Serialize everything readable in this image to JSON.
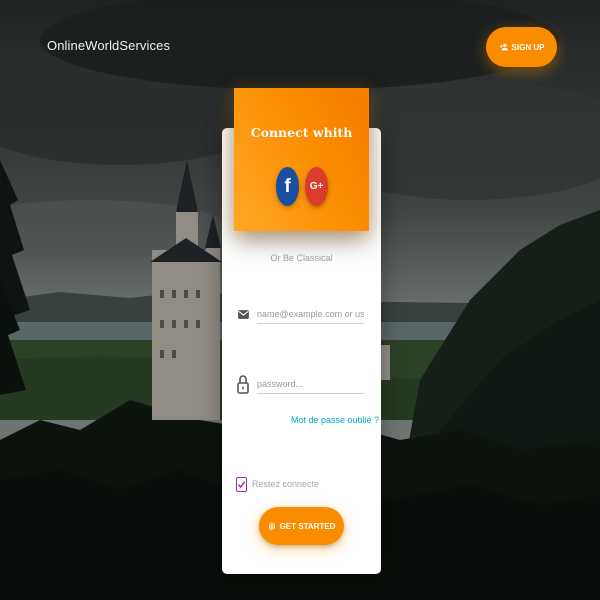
{
  "brand": {
    "name": "OnlineWorldServices"
  },
  "header": {
    "signup_label": "SIGN UP",
    "signup_icon": "person-add-icon"
  },
  "card": {
    "title": "Connect whith",
    "social": [
      {
        "name": "facebook",
        "glyph": "f",
        "color": "#1a4fa0"
      },
      {
        "name": "google-plus",
        "glyph": "G+",
        "color": "#dd3b2d"
      }
    ],
    "divider": "Or Be Classical",
    "email": {
      "placeholder": "name@example.com or userna",
      "value": "",
      "icon": "email-icon"
    },
    "password": {
      "placeholder": "password...",
      "value": "",
      "icon": "lock-icon"
    },
    "forgot_link": "Mot de passe oublié ?",
    "remember": {
      "label": "Restez connecte",
      "checked": true
    },
    "submit": {
      "label": "GET STARTED",
      "icon": "fingerprint-icon"
    }
  },
  "colors": {
    "accent": "#fb8c00",
    "link": "#00acc1",
    "checkbox": "#9c27b0",
    "facebook": "#1a4fa0",
    "google": "#dd3b2d"
  }
}
